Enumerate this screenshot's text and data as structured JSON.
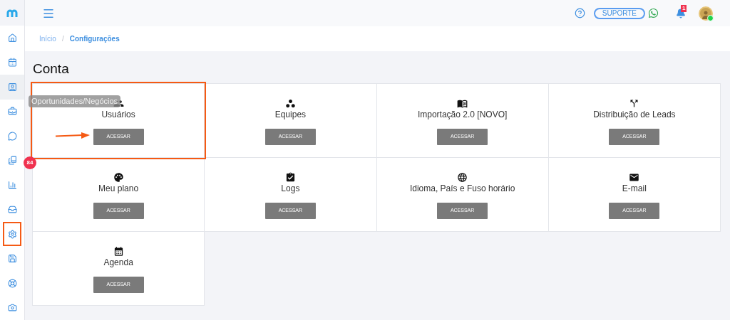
{
  "header": {
    "support_label": "SUPORTE",
    "notification_count": "1",
    "online": true
  },
  "sidebar": {
    "items": [
      {
        "selected": false,
        "highlighted": false
      },
      {
        "selected": false,
        "highlighted": false
      },
      {
        "selected": true,
        "highlighted": false
      },
      {
        "selected": false,
        "highlighted": false
      },
      {
        "selected": false,
        "highlighted": false
      },
      {
        "selected": false,
        "highlighted": false
      },
      {
        "selected": false,
        "highlighted": false
      },
      {
        "selected": false,
        "highlighted": false
      },
      {
        "selected": false,
        "highlighted": true
      },
      {
        "selected": false,
        "highlighted": false
      },
      {
        "selected": false,
        "highlighted": false
      },
      {
        "selected": false,
        "highlighted": false
      }
    ],
    "tooltip": "Oportunidades/Negócios",
    "badge": "84"
  },
  "breadcrumb_separator": "/",
  "breadcrumb": [
    {
      "label": "Início",
      "selected": false
    },
    {
      "label": "Configurações",
      "selected": true
    }
  ],
  "section_title": "Conta",
  "cards": [
    {
      "title": "Usuários",
      "button": "ACESSAR",
      "highlighted": true
    },
    {
      "title": "Equipes",
      "button": "ACESSAR",
      "highlighted": false
    },
    {
      "title": "Importação 2.0 [NOVO]",
      "button": "ACESSAR",
      "highlighted": false
    },
    {
      "title": "Distribuição de Leads",
      "button": "ACESSAR",
      "highlighted": false
    },
    {
      "title": "Meu plano",
      "button": "ACESSAR",
      "highlighted": false
    },
    {
      "title": "Logs",
      "button": "ACESSAR",
      "highlighted": false
    },
    {
      "title": "Idioma, País e Fuso horário",
      "button": "ACESSAR",
      "highlighted": false
    },
    {
      "title": "E-mail",
      "button": "ACESSAR",
      "highlighted": false
    },
    {
      "title": "Agenda",
      "button": "ACESSAR",
      "highlighted": false
    }
  ]
}
